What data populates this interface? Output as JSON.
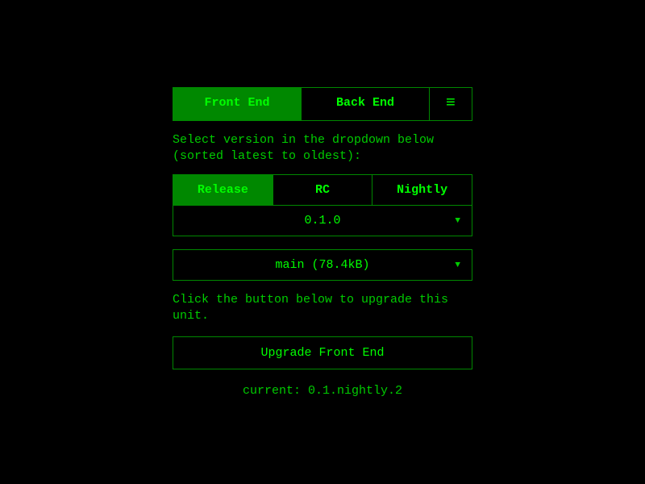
{
  "mainTabs": {
    "frontEnd": "Front End",
    "backEnd": "Back End"
  },
  "instruction1": "Select version in the dropdown below (sorted latest to oldest):",
  "channels": {
    "release": "Release",
    "rc": "RC",
    "nightly": "Nightly"
  },
  "versionDropdown": {
    "selected": "0.1.0"
  },
  "branchDropdown": {
    "selected": "main (78.4kB)"
  },
  "instruction2": "Click the button below to upgrade this unit.",
  "upgradeButton": "Upgrade Front End",
  "currentVersion": "current: 0.1.nightly.2"
}
